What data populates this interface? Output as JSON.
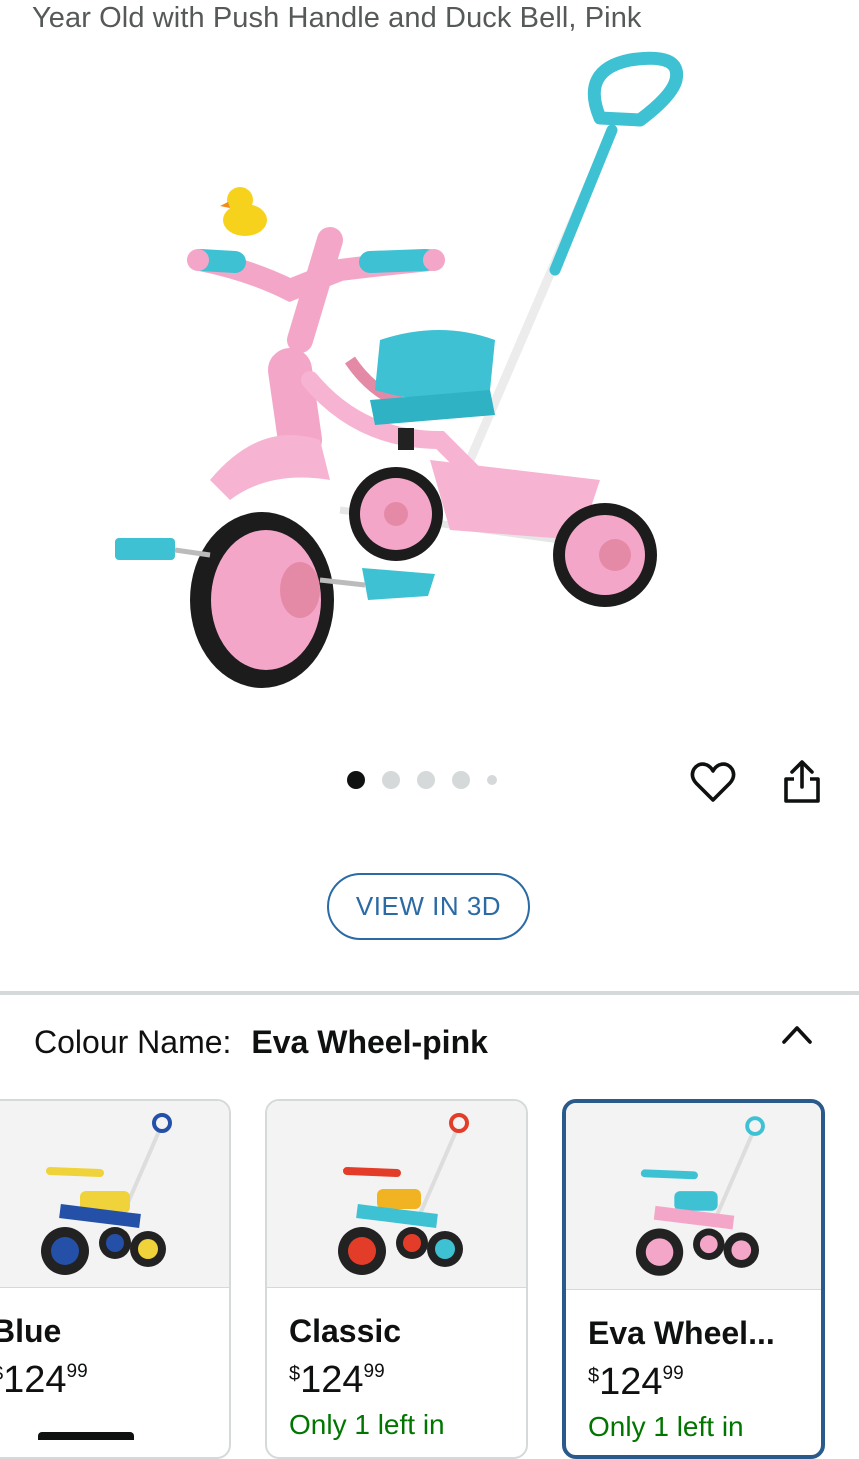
{
  "product": {
    "title": "Year Old with Push Handle and Duck Bell, Pink"
  },
  "gallery": {
    "dots": 5,
    "active_index": 0,
    "view_3d_label": "VIEW IN 3D"
  },
  "icons": {
    "wishlist": "heart-icon",
    "share": "share-icon",
    "collapse": "chevron-up-icon"
  },
  "variation": {
    "label": "Colour Name:",
    "selected_value": "Eva Wheel-pink",
    "options": [
      {
        "name": "Blue",
        "price_currency": "$",
        "price_whole": "124",
        "price_fraction": "99",
        "stock": ""
      },
      {
        "name": "Classic",
        "price_currency": "$",
        "price_whole": "124",
        "price_fraction": "99",
        "stock": "Only 1 left in"
      },
      {
        "name": "Eva Wheel...",
        "price_currency": "$",
        "price_whole": "124",
        "price_fraction": "99",
        "stock": "Only 1 left in"
      }
    ]
  },
  "colors": {
    "link_blue": "#2a6aa5",
    "selected_border": "#2a5a8c",
    "stock_green": "#007600",
    "trike_pink": "#f4a6c9",
    "trike_cyan": "#3ec1d3"
  }
}
